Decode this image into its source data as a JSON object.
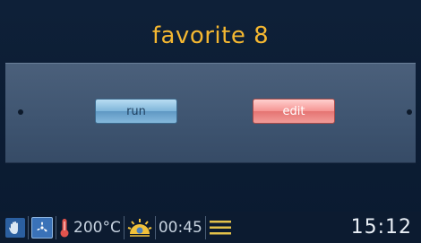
{
  "header": {
    "title": "favorite 8"
  },
  "buttons": {
    "run_label": "run",
    "edit_label": "edit"
  },
  "status_bar": {
    "temperature": "200°C",
    "duration": "00:45",
    "clock": "15:12",
    "icons": [
      "hand-icon",
      "fan-mode-icon",
      "thermometer-icon",
      "heat-level-icon",
      "shelf-level-icon"
    ]
  },
  "colors": {
    "title": "#f4b731",
    "run_button": "#7fb5da",
    "edit_button": "#f28e8c",
    "panel": "#45597a"
  }
}
